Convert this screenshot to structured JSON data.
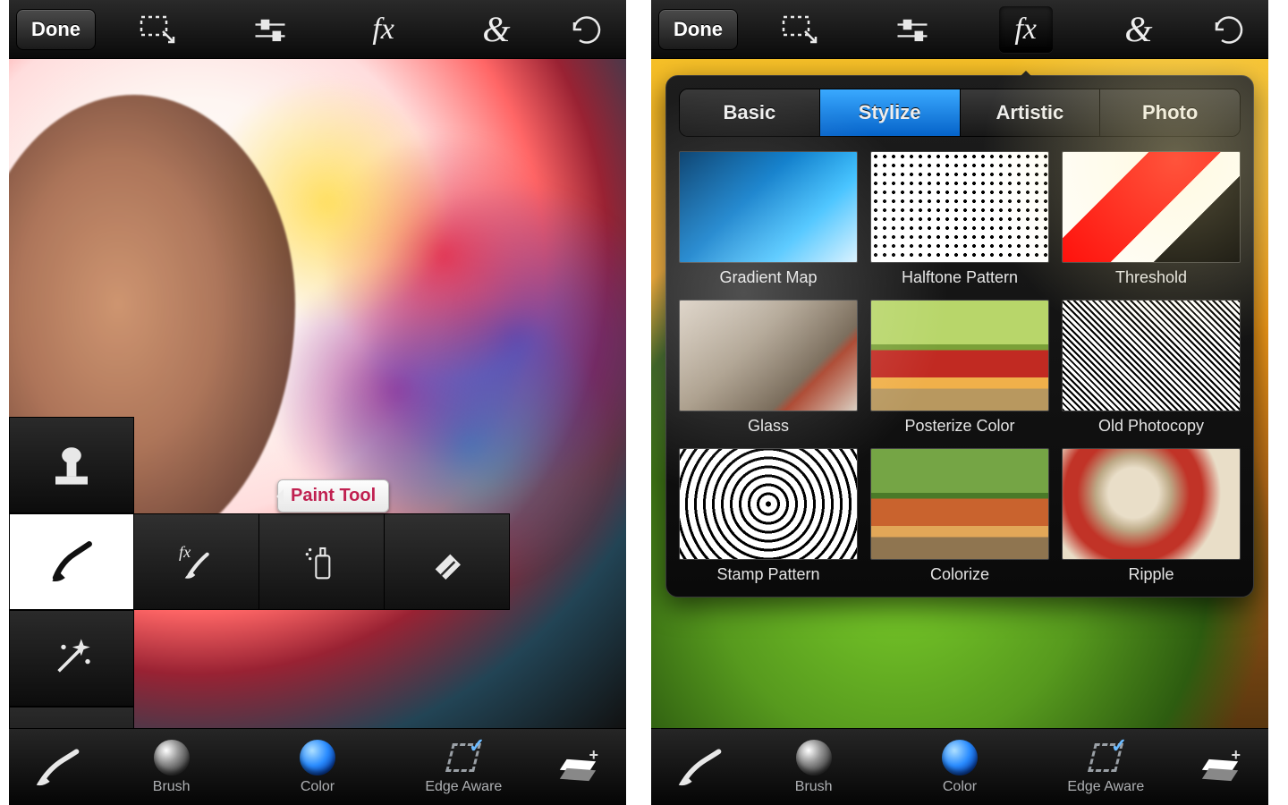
{
  "topbar": {
    "done_label": "Done",
    "fx_label": "fx",
    "amp_label": "&"
  },
  "tooltip": {
    "paint_tool": "Paint Tool"
  },
  "fx_tabs": [
    "Basic",
    "Stylize",
    "Artistic",
    "Photo"
  ],
  "fx_active_tab": "Stylize",
  "fx_items": [
    {
      "label": "Gradient Map",
      "cls": "th-gradientmap"
    },
    {
      "label": "Halftone Pattern",
      "cls": "th-halftone"
    },
    {
      "label": "Threshold",
      "cls": "th-threshold"
    },
    {
      "label": "Glass",
      "cls": "th-glass"
    },
    {
      "label": "Posterize Color",
      "cls": "th-posterize"
    },
    {
      "label": "Old Photocopy",
      "cls": "th-photocopy"
    },
    {
      "label": "Stamp Pattern",
      "cls": "th-stamp"
    },
    {
      "label": "Colorize",
      "cls": "th-colorize"
    },
    {
      "label": "Ripple",
      "cls": "th-ripple"
    }
  ],
  "bottom": {
    "brush_label": "Brush",
    "color_label": "Color",
    "edge_label": "Edge Aware"
  }
}
